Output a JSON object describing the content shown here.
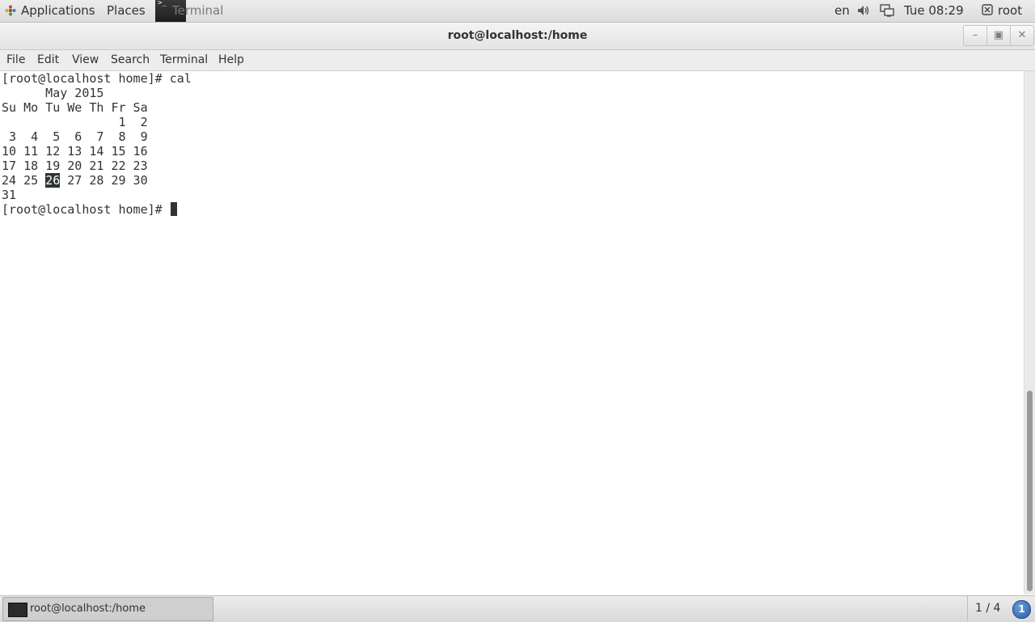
{
  "top_panel": {
    "applications_label": "Applications",
    "places_label": "Places",
    "active_task_label": "Terminal",
    "language": "en",
    "clock": "Tue 08:29",
    "user": "root"
  },
  "window": {
    "title": "root@localhost:/home"
  },
  "menu_bar": {
    "items": [
      "File",
      "Edit",
      "View",
      "Search",
      "Terminal",
      "Help"
    ]
  },
  "terminal": {
    "lines": [
      "[root@localhost home]# cal",
      "      May 2015",
      "Su Mo Tu We Th Fr Sa",
      "                1  2",
      " 3  4  5  6  7  8  9",
      "10 11 12 13 14 15 16",
      "17 18 19 20 21 22 23",
      "24 25 26 27 28 29 30",
      "31",
      "[root@localhost home]# "
    ],
    "line7_before_highlight": "24 25 ",
    "highlighted_day": "26",
    "line7_after_highlight": " 27 28 29 30",
    "prompt": "[root@localhost home]# "
  },
  "bottom_panel": {
    "taskbar_label": "root@localhost:/home",
    "workspace": "1 / 4",
    "notification_count": "1"
  },
  "icons": [
    "apps-icon",
    "volume-icon",
    "network-icon",
    "user-icon",
    "terminal-icon"
  ],
  "colors": {
    "panel_bg": "#e4e4e4",
    "terminal_fg": "#2e3436",
    "terminal_bg": "#ffffff",
    "highlight_bg": "#2e3436",
    "badge": "#2b5ea8"
  }
}
